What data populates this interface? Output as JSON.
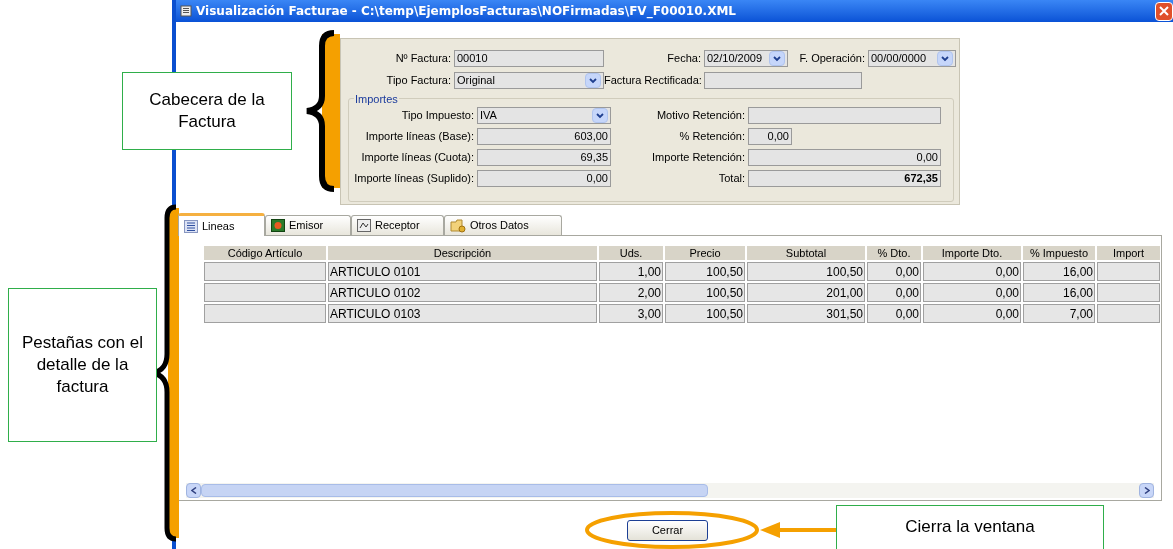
{
  "window": {
    "title": "Visualización Facturae - C:\\temp\\EjemplosFacturas\\NOFirmadas\\FV_F00010.XML"
  },
  "header": {
    "row_1": [
      {
        "label": "Nº Factura:",
        "value": "00010",
        "kind": "text"
      },
      {
        "label": "Fecha:",
        "value": "02/10/2009",
        "kind": "combo"
      },
      {
        "label": "F. Operación:",
        "value": "00/00/0000",
        "kind": "combo"
      }
    ],
    "row_2": [
      {
        "label": "Tipo Factura:",
        "value": "Original",
        "kind": "combo"
      },
      {
        "label": "Factura Rectificada:",
        "kind": "text"
      }
    ],
    "importes": {
      "title": "Importes",
      "left": [
        {
          "label": "Tipo Impuesto:",
          "value": "IVA",
          "kind": "combo"
        },
        {
          "label": "Importe líneas (Base):",
          "value": "603,00",
          "kind": "number"
        },
        {
          "label": "Importe líneas (Cuota):",
          "value": "69,35",
          "kind": "number"
        },
        {
          "label": "Importe líneas (Suplido):",
          "value": "0,00",
          "kind": "number"
        }
      ],
      "right": [
        {
          "label": "Motivo Retención:",
          "kind": "text"
        },
        {
          "label": "% Retención:",
          "value": "0,00",
          "kind": "short"
        },
        {
          "label": "Importe Retención:",
          "value": "0,00",
          "kind": "number"
        },
        {
          "label": "Total:",
          "value": "672,35",
          "kind": "total"
        }
      ]
    }
  },
  "tabs": [
    {
      "label": "Lineas",
      "selected": true
    },
    {
      "label": "Emisor",
      "selected": false
    },
    {
      "label": "Receptor",
      "selected": false
    },
    {
      "label": "Otros Datos",
      "selected": false
    }
  ],
  "table": {
    "columns": [
      "Código Artículo",
      "Descripción",
      "Uds.",
      "Precio",
      "Subtotal",
      "% Dto.",
      "Importe Dto.",
      "% Impuesto",
      "Import"
    ],
    "rows": [
      [
        "",
        "ARTICULO 0101",
        "1,00",
        "100,50",
        "100,50",
        "0,00",
        "0,00",
        "16,00",
        ""
      ],
      [
        "",
        "ARTICULO 0102",
        "2,00",
        "100,50",
        "201,00",
        "0,00",
        "0,00",
        "16,00",
        ""
      ],
      [
        "",
        "ARTICULO 0103",
        "3,00",
        "100,50",
        "301,50",
        "0,00",
        "0,00",
        "7,00",
        ""
      ]
    ]
  },
  "buttons": [
    "Cerrar"
  ],
  "annotations": [
    {
      "text": "Cabecera de la Factura"
    },
    {
      "text": "Pestañas con el detalle de la factura"
    },
    {
      "text": "Cierra la ventana"
    }
  ]
}
